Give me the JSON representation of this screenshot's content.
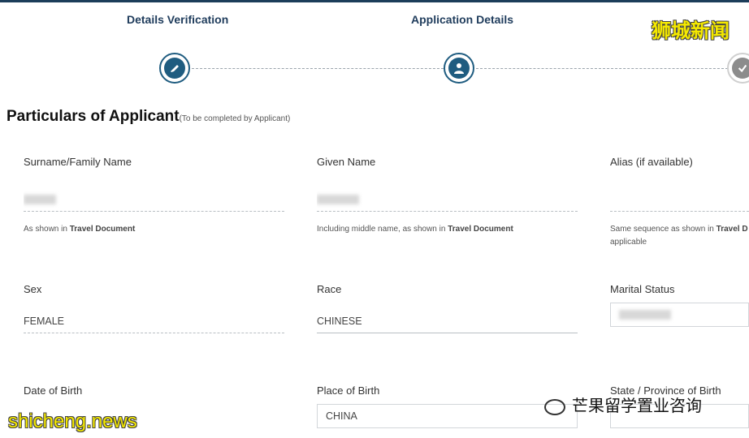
{
  "steps": [
    {
      "title": "Details Verification"
    },
    {
      "title": "Application Details"
    }
  ],
  "section": {
    "title": "Particulars of Applicant",
    "subtitle": "(To be completed by Applicant)"
  },
  "fields": {
    "surname": {
      "label": "Surname/Family Name",
      "value": "",
      "hint_prefix": "As shown in ",
      "hint_bold": "Travel Document"
    },
    "given_name": {
      "label": "Given Name",
      "value": "",
      "hint_prefix": "Including middle name, as shown in ",
      "hint_bold": "Travel Document"
    },
    "alias": {
      "label": "Alias (if available)",
      "value": "",
      "hint_prefix": "Same sequence as shown in ",
      "hint_bold": "Travel D",
      "hint_suffix": "applicable"
    },
    "sex": {
      "label": "Sex",
      "value": "FEMALE"
    },
    "race": {
      "label": "Race",
      "value": "CHINESE"
    },
    "marital": {
      "label": "Marital Status",
      "value": ""
    },
    "dob": {
      "label": "Date of Birth",
      "value": ""
    },
    "pob": {
      "label": "Place of Birth",
      "value": "CHINA"
    },
    "state": {
      "label": "State / Province of Birth",
      "value": ""
    }
  },
  "watermarks": {
    "top_right": "狮城新闻",
    "bottom_left": "shicheng.news",
    "bottom_right": "芒果留学置业咨询"
  },
  "icons": {
    "step1": "verified-badge-icon",
    "step2": "user-icon",
    "step3": "verified-badge-icon"
  },
  "colors": {
    "primary": "#1f5c80",
    "heading": "#1f3c5c",
    "watermark": "#f5e900"
  }
}
